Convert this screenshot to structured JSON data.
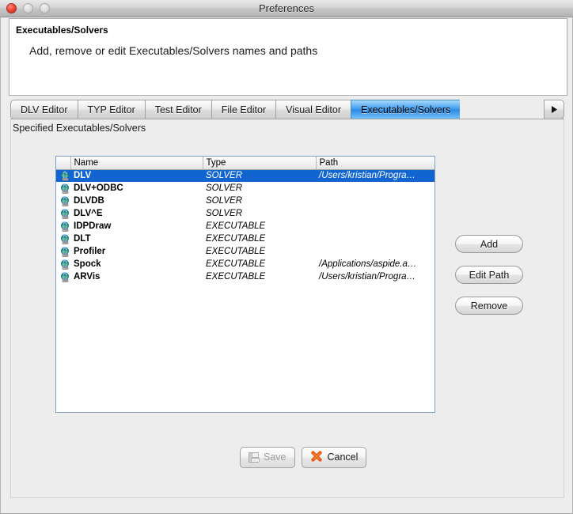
{
  "window": {
    "title": "Preferences",
    "traffic_lights": [
      "close-button",
      "minimize-button",
      "maximize-button"
    ]
  },
  "header": {
    "title": "Executables/Solvers",
    "description": "Add, remove or edit Executables/Solvers names and paths"
  },
  "tabs": {
    "items": [
      {
        "label": "DLV Editor",
        "selected": false
      },
      {
        "label": "TYP Editor",
        "selected": false
      },
      {
        "label": "Test Editor",
        "selected": false
      },
      {
        "label": "File Editor",
        "selected": false
      },
      {
        "label": "Visual Editor",
        "selected": false
      },
      {
        "label": "Executables/Solvers",
        "selected": true
      }
    ],
    "scroll_right_icon": "triangle-right-icon",
    "selected_color": "#3f9ef0"
  },
  "content": {
    "section_label": "Specified Executables/Solvers",
    "table": {
      "columns": [
        "",
        "Name",
        "Type",
        "Path"
      ],
      "selection_color": "#1265d0",
      "rows": [
        {
          "icon": "globe-icon",
          "name": "DLV",
          "type": "SOLVER",
          "path": "/Users/kristian/Progra…",
          "selected": true
        },
        {
          "icon": "globe-icon",
          "name": "DLV+ODBC",
          "type": "SOLVER",
          "path": "",
          "selected": false
        },
        {
          "icon": "globe-icon",
          "name": "DLVDB",
          "type": "SOLVER",
          "path": "",
          "selected": false
        },
        {
          "icon": "globe-icon",
          "name": "DLV^E",
          "type": "SOLVER",
          "path": "",
          "selected": false
        },
        {
          "icon": "globe-icon",
          "name": "IDPDraw",
          "type": "EXECUTABLE",
          "path": "",
          "selected": false
        },
        {
          "icon": "globe-icon",
          "name": "DLT",
          "type": "EXECUTABLE",
          "path": "",
          "selected": false
        },
        {
          "icon": "globe-icon",
          "name": "Profiler",
          "type": "EXECUTABLE",
          "path": "",
          "selected": false
        },
        {
          "icon": "globe-icon",
          "name": "Spock",
          "type": "EXECUTABLE",
          "path": "/Applications/aspide.a…",
          "selected": false
        },
        {
          "icon": "globe-icon",
          "name": "ARVis",
          "type": "EXECUTABLE",
          "path": "/Users/kristian/Progra…",
          "selected": false
        }
      ]
    },
    "side_buttons": [
      {
        "label": "Add"
      },
      {
        "label": "Edit Path"
      },
      {
        "label": "Remove"
      }
    ],
    "bottom_buttons": [
      {
        "label": "Save",
        "icon": "floppy-disk-icon",
        "enabled": false
      },
      {
        "label": "Cancel",
        "icon": "red-cross-icon",
        "enabled": true
      }
    ]
  }
}
